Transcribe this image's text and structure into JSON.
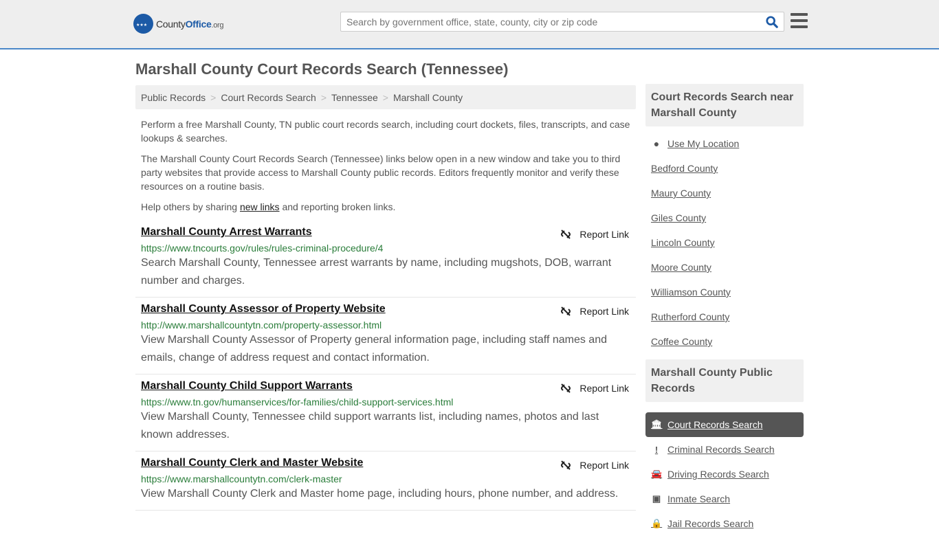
{
  "header": {
    "logo_main": "County",
    "logo_bold": "Office",
    "logo_tld": ".org",
    "search_placeholder": "Search by government office, state, county, city or zip code"
  },
  "page_title": "Marshall County Court Records Search (Tennessee)",
  "breadcrumb": [
    "Public Records",
    "Court Records Search",
    "Tennessee",
    "Marshall County"
  ],
  "intro": {
    "p1": "Perform a free Marshall County, TN public court records search, including court dockets, files, transcripts, and case lookups & searches.",
    "p2": "The Marshall County Court Records Search (Tennessee) links below open in a new window and take you to third party websites that provide access to Marshall County public records. Editors frequently monitor and verify these resources on a routine basis.",
    "p3_pre": "Help others by sharing ",
    "p3_link": "new links",
    "p3_post": " and reporting broken links."
  },
  "report_label": "Report Link",
  "items": [
    {
      "title": "Marshall County Arrest Warrants",
      "url": "https://www.tncourts.gov/rules/rules-criminal-procedure/4",
      "desc": "Search Marshall County, Tennessee arrest warrants by name, including mugshots, DOB, warrant number and charges."
    },
    {
      "title": "Marshall County Assessor of Property Website",
      "url": "http://www.marshallcountytn.com/property-assessor.html",
      "desc": "View Marshall County Assessor of Property general information page, including staff names and emails, change of address request and contact information."
    },
    {
      "title": "Marshall County Child Support Warrants",
      "url": "https://www.tn.gov/humanservices/for-families/child-support-services.html",
      "desc": "View Marshall County, Tennessee child support warrants list, including names, photos and last known addresses."
    },
    {
      "title": "Marshall County Clerk and Master Website",
      "url": "https://www.marshallcountytn.com/clerk-master",
      "desc": "View Marshall County Clerk and Master home page, including hours, phone number, and address."
    }
  ],
  "sidebar": {
    "near_title": "Court Records Search near Marshall County",
    "use_location": "Use My Location",
    "near": [
      "Bedford County",
      "Maury County",
      "Giles County",
      "Lincoln County",
      "Moore County",
      "Williamson County",
      "Rutherford County",
      "Coffee County"
    ],
    "pr_title": "Marshall County Public Records",
    "pr": [
      {
        "label": "Court Records Search",
        "icon": "courthouse-icon",
        "glyph": "🏛",
        "active": true
      },
      {
        "label": "Criminal Records Search",
        "icon": "exclamation-icon",
        "glyph": "!"
      },
      {
        "label": "Driving Records Search",
        "icon": "car-icon",
        "glyph": "🚘"
      },
      {
        "label": "Inmate Search",
        "icon": "id-badge-icon",
        "glyph": "▣"
      },
      {
        "label": "Jail Records Search",
        "icon": "lock-icon",
        "glyph": "🔒"
      }
    ]
  }
}
